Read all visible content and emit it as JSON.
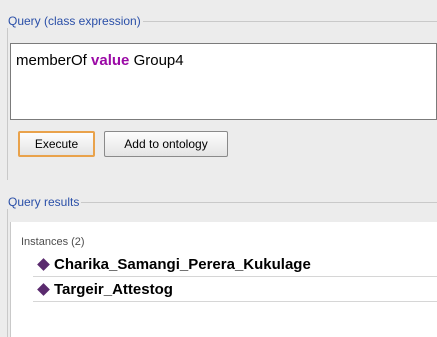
{
  "query_panel": {
    "legend": "Query (class expression)",
    "expression": {
      "property": "memberOf",
      "keyword": "value",
      "individual": "Group4"
    },
    "execute_label": "Execute",
    "add_label": "Add to ontology",
    "colors": {
      "keyword": "#9b0aa6",
      "legend": "#2a4fa8",
      "focus_border": "#e9a24b"
    }
  },
  "results_panel": {
    "legend": "Query results",
    "instances_header": "Instances (2)",
    "instances": [
      {
        "label": "Charika_Samangi_Perera_Kukulage",
        "icon": "individual-diamond-icon"
      },
      {
        "label": "Targeir_Attestog",
        "icon": "individual-diamond-icon"
      }
    ]
  }
}
